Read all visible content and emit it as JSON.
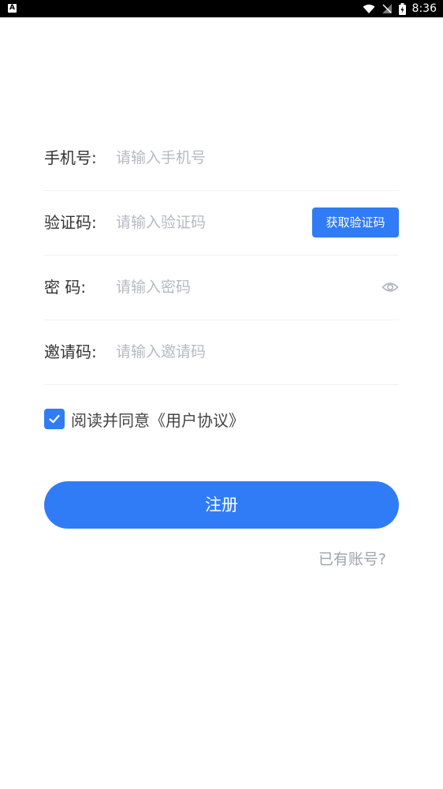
{
  "status_bar": {
    "notification_icon_letter": "A",
    "time": "8:36",
    "icons": [
      "wifi-icon",
      "signal-off-icon",
      "battery-charging-icon"
    ]
  },
  "form": {
    "phone": {
      "label": "手机号:",
      "placeholder": "请输入手机号"
    },
    "code": {
      "label": "验证码:",
      "placeholder": "请输入验证码",
      "button": "获取验证码"
    },
    "password": {
      "label": "密 码:",
      "placeholder": "请输入密码",
      "icon": "eye-icon"
    },
    "invite": {
      "label": "邀请码:",
      "placeholder": "请输入邀请码"
    }
  },
  "agreement": {
    "checked": true,
    "text": "阅读并同意《用户协议》"
  },
  "register_button": "注册",
  "login_link": "已有账号?",
  "colors": {
    "accent": "#2f7cf6",
    "placeholder": "#b5bac2",
    "label": "#333333",
    "muted": "#9ea3ab"
  }
}
